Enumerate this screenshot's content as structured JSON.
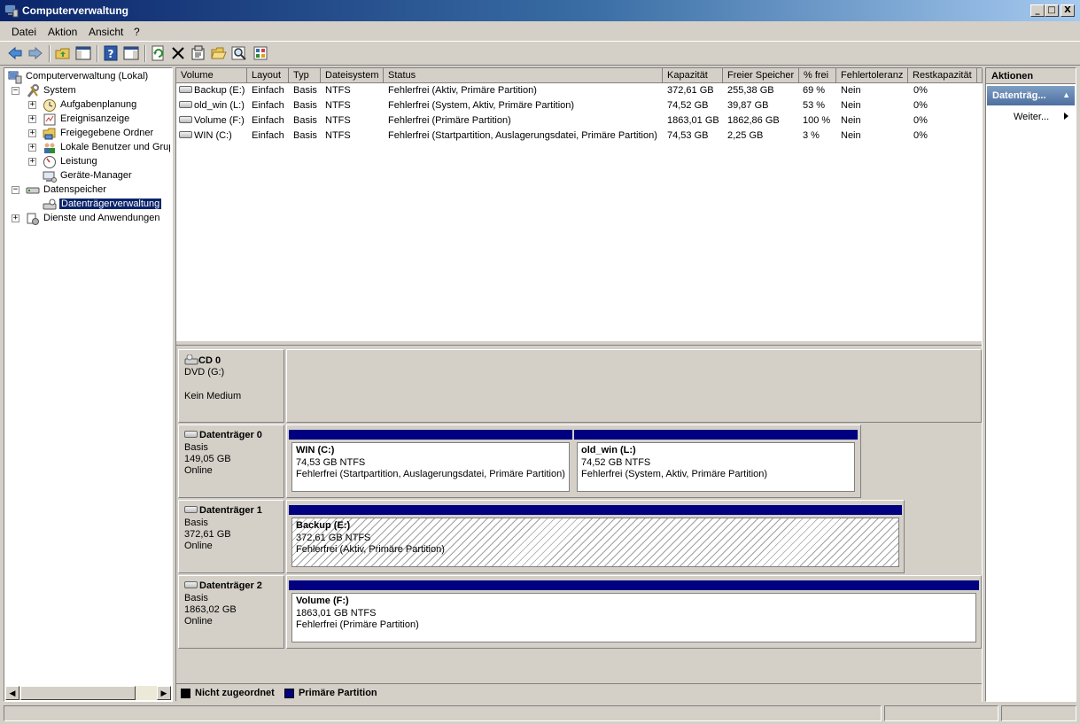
{
  "window": {
    "title": "Computerverwaltung",
    "controls": {
      "minimize": "_",
      "maximize": "□",
      "close": "X"
    }
  },
  "menu": [
    "Datei",
    "Aktion",
    "Ansicht",
    "?"
  ],
  "toolbar": {
    "buttons": [
      "back-icon",
      "forward-icon",
      "up-folder-icon",
      "show-hide-tree-icon",
      "help-icon",
      "show-hide-action-pane-icon",
      "refresh-icon",
      "delete-icon",
      "properties-icon",
      "open-icon",
      "search-icon",
      "export-icon"
    ]
  },
  "tree": {
    "root": "Computerverwaltung (Lokal)",
    "system": "System",
    "aufgabenplanung": "Aufgabenplanung",
    "ereignisanzeige": "Ereignisanzeige",
    "freigegebene_ordner": "Freigegebene Ordner",
    "lokale_benutzer": "Lokale Benutzer und Grupp",
    "leistung": "Leistung",
    "geraete_manager": "Geräte-Manager",
    "datenspeicher": "Datenspeicher",
    "datentraegerverwaltung": "Datenträgerverwaltung",
    "dienste": "Dienste und Anwendungen",
    "expander_plus": "+",
    "expander_minus": "−"
  },
  "volume_table": {
    "columns": [
      "Volume",
      "Layout",
      "Typ",
      "Dateisystem",
      "Status",
      "Kapazität",
      "Freier Speicher",
      "% frei",
      "Fehlertoleranz",
      "Restkapazität"
    ],
    "rows": [
      [
        "Backup (E:)",
        "Einfach",
        "Basis",
        "NTFS",
        "Fehlerfrei (Aktiv, Primäre Partition)",
        "372,61 GB",
        "255,38 GB",
        "69 %",
        "Nein",
        "0%"
      ],
      [
        "old_win (L:)",
        "Einfach",
        "Basis",
        "NTFS",
        "Fehlerfrei (System, Aktiv, Primäre Partition)",
        "74,52 GB",
        "39,87 GB",
        "53 %",
        "Nein",
        "0%"
      ],
      [
        "Volume (F:)",
        "Einfach",
        "Basis",
        "NTFS",
        "Fehlerfrei (Primäre Partition)",
        "1863,01 GB",
        "1862,86 GB",
        "100 %",
        "Nein",
        "0%"
      ],
      [
        "WIN (C:)",
        "Einfach",
        "Basis",
        "NTFS",
        "Fehlerfrei (Startpartition, Auslagerungsdatei, Primäre Partition)",
        "74,53 GB",
        "2,25 GB",
        "3 %",
        "Nein",
        "0%"
      ]
    ]
  },
  "disks": {
    "cd0": {
      "name": "CD 0",
      "line1": "DVD (G:)",
      "line2": "Kein Medium"
    },
    "disk0": {
      "name": "Datenträger 0",
      "type": "Basis",
      "size": "149,05 GB",
      "state": "Online",
      "partitions": [
        {
          "title": "WIN  (C:)",
          "size": "74,53 GB NTFS",
          "status": "Fehlerfrei (Startpartition, Auslagerungsdatei, Primäre Partition)"
        },
        {
          "title": "old_win  (L:)",
          "size": "74,52 GB NTFS",
          "status": "Fehlerfrei (System, Aktiv, Primäre Partition)"
        }
      ]
    },
    "disk1": {
      "name": "Datenträger 1",
      "type": "Basis",
      "size": "372,61 GB",
      "state": "Online",
      "partitions": [
        {
          "title": "Backup  (E:)",
          "size": "372,61 GB NTFS",
          "status": "Fehlerfrei (Aktiv, Primäre Partition)"
        }
      ]
    },
    "disk2": {
      "name": "Datenträger 2",
      "type": "Basis",
      "size": "1863,02 GB",
      "state": "Online",
      "partitions": [
        {
          "title": "Volume  (F:)",
          "size": "1863,01 GB NTFS",
          "status": "Fehlerfrei (Primäre Partition)"
        }
      ]
    }
  },
  "legend": {
    "unallocated": "Nicht zugeordnet",
    "primary": "Primäre Partition",
    "unallocated_color": "#000000",
    "primary_color": "#000080"
  },
  "actions": {
    "title": "Aktionen",
    "group": "Datenträg...",
    "group_caret": "▲",
    "more": "Weiter..."
  },
  "scroll": {
    "left_arrow": "◀",
    "right_arrow": "▶"
  }
}
